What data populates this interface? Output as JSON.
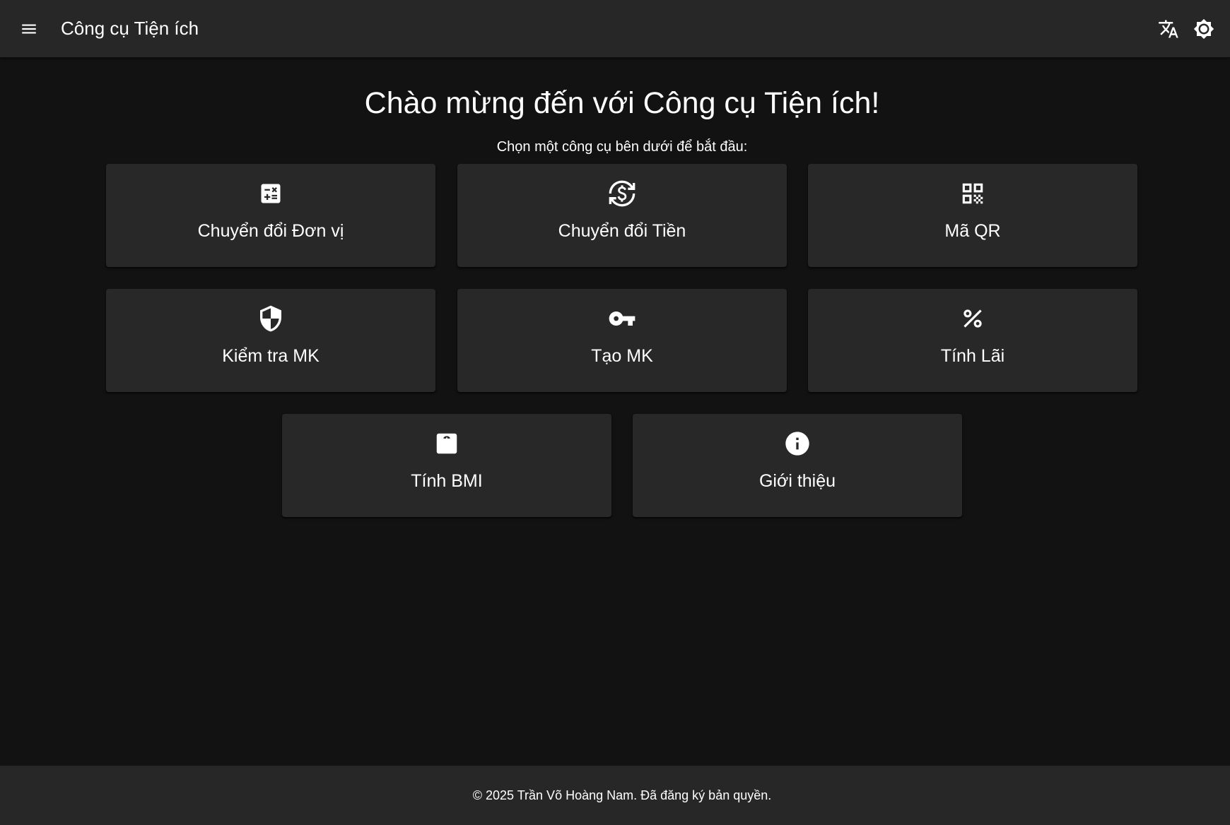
{
  "appbar": {
    "title": "Công cụ Tiện ích",
    "menu_icon": "menu-icon",
    "translate_icon": "translate-icon",
    "theme_icon": "brightness-icon"
  },
  "main": {
    "heading": "Chào mừng đến với Công cụ Tiện ích!",
    "subheading": "Chọn một công cụ bên dưới để bắt đầu:"
  },
  "tools": [
    {
      "label": "Chuyển đổi Đơn vị",
      "icon": "calculate-icon"
    },
    {
      "label": "Chuyển đổi Tiền",
      "icon": "currency-exchange-icon"
    },
    {
      "label": "Mã QR",
      "icon": "qr-code-icon"
    },
    {
      "label": "Kiểm tra MK",
      "icon": "shield-icon"
    },
    {
      "label": "Tạo MK",
      "icon": "key-icon"
    },
    {
      "label": "Tính Lãi",
      "icon": "percent-icon"
    },
    {
      "label": "Tính BMI",
      "icon": "scale-icon"
    },
    {
      "label": "Giới thiệu",
      "icon": "info-icon"
    }
  ],
  "footer": {
    "text": "© 2025 Trần Võ Hoàng Nam. Đã đăng ký bản quyền."
  },
  "colors": {
    "background": "#121212",
    "surface": "#282828",
    "appbar": "#272727",
    "text": "#ffffff"
  }
}
